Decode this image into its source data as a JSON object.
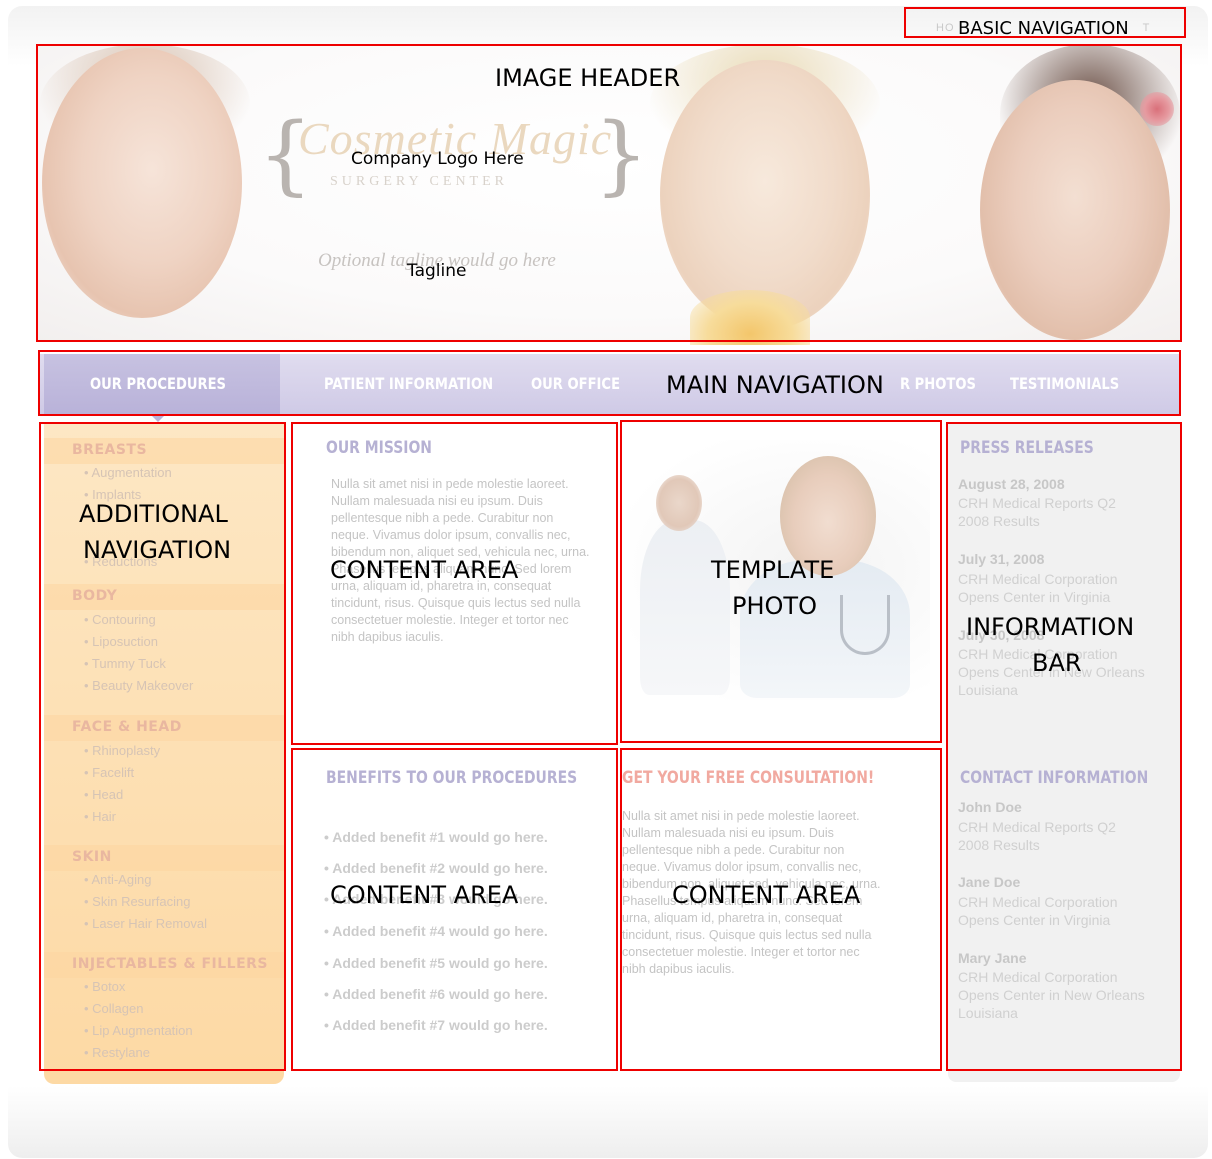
{
  "annotations": {
    "basic_navigation": "BASIC NAVIGATION",
    "image_header": "IMAGE HEADER",
    "company_logo": "Company Logo Here",
    "tagline": "Tagline",
    "main_navigation": "MAIN NAVIGATION",
    "additional_navigation_1": "ADDITIONAL",
    "additional_navigation_2": "NAVIGATION",
    "content_area": "CONTENT AREA",
    "template_photo_1": "TEMPLATE",
    "template_photo_2": "PHOTO",
    "information_bar_1": "INFORMATION",
    "information_bar_2": "BAR"
  },
  "header": {
    "basic_nav_partial": "HO",
    "basic_nav_suffix": "T",
    "logo_script": "Cosmetic Magic",
    "logo_sub": "SURGERY CENTER",
    "tagline_ghost": "Optional tagline would go here"
  },
  "main_nav": {
    "items": [
      "OUR PROCEDURES",
      "PATIENT INFORMATION",
      "OUR OFFICE",
      "R PHOTOS",
      "TESTIMONIALS"
    ]
  },
  "sidebar": {
    "categories": [
      "BREASTS",
      "BODY",
      "FACE & HEAD",
      "SKIN",
      "INJECTABLES & FILLERS"
    ],
    "links": {
      "breasts": [
        "• Augmentation",
        "• Implants",
        "• Reductions"
      ],
      "body": [
        "• Contouring",
        "• Liposuction",
        "• Tummy Tuck",
        "• Beauty Makeover"
      ],
      "face_head": [
        "• Rhinoplasty",
        "• Facelift",
        "• Head",
        "• Hair"
      ],
      "skin": [
        "• Anti-Aging",
        "• Skin Resurfacing",
        "• Laser Hair Removal"
      ],
      "injectables": [
        "• Botox",
        "• Collagen",
        "• Lip Augmentation",
        "• Restylane"
      ]
    }
  },
  "mission": {
    "heading": "OUR MISSION",
    "body": "Nulla sit amet nisi in pede molestie laoreet. Nullam malesuada nisi eu ipsum. Duis pellentesque nibh a pede. Curabitur non neque. Vivamus dolor ipsum, convallis nec, bibendum non, aliquet sed, vehicula nec, urna. Phasellus tempus aliquam nunc. Sed lorem urna, aliquam id, pharetra in, consequat tincidunt, risus. Quisque quis lectus sed nulla consectetuer molestie. Integer et tortor nec nibh dapibus iaculis."
  },
  "benefits": {
    "heading": "BENEFITS TO OUR PROCEDURES",
    "items": [
      "• Added benefit #1 would go here.",
      "• Added benefit #2 would go here.",
      "• Added benefit #3 would go here.",
      "• Added benefit #4 would go here.",
      "• Added benefit #5 would go here.",
      "• Added benefit #6 would go here.",
      "• Added benefit #7 would go here."
    ]
  },
  "consultation": {
    "heading": "GET YOUR FREE CONSULTATION!",
    "body": "Nulla sit amet nisi in pede molestie laoreet. Nullam malesuada nisi eu ipsum. Duis pellentesque nibh a pede. Curabitur non neque. Vivamus dolor ipsum, convallis nec, bibendum non, aliquet sed, vehicula nec, urna. Phasellus tempus aliquam nunc. Sed lorem urna, aliquam id, pharetra in, consequat tincidunt, risus. Quisque quis lectus sed nulla consectetuer molestie. Integer et tortor nec nibh dapibus iaculis."
  },
  "press": {
    "heading": "PRESS RELEASES",
    "items": [
      {
        "date": "August 28, 2008",
        "text": "CRH Medical Reports Q2 2008 Results"
      },
      {
        "date": "July 31, 2008",
        "text": "CRH Medical Corporation Opens Center in Virginia"
      },
      {
        "date": "July 30, 2008",
        "text": "CRH Medical Corporation Opens Center in New Orleans Louisiana"
      }
    ]
  },
  "contact": {
    "heading": "CONTACT INFORMATION",
    "items": [
      {
        "name": "John Doe",
        "text": "CRH Medical Reports Q2 2008 Results"
      },
      {
        "name": "Jane Doe",
        "text": "CRH Medical Corporation Opens Center in Virginia"
      },
      {
        "name": "Mary Jane",
        "text": "CRH Medical Corporation Opens Center in New Orleans Louisiana"
      }
    ]
  },
  "colors": {
    "annotation_border": "#ee0000",
    "nav_bar": "#cfcae6",
    "sidebar": "#fdd9a4",
    "heading_ghost": "#b6b1d3",
    "consult_heading": "#f1a9a0"
  }
}
